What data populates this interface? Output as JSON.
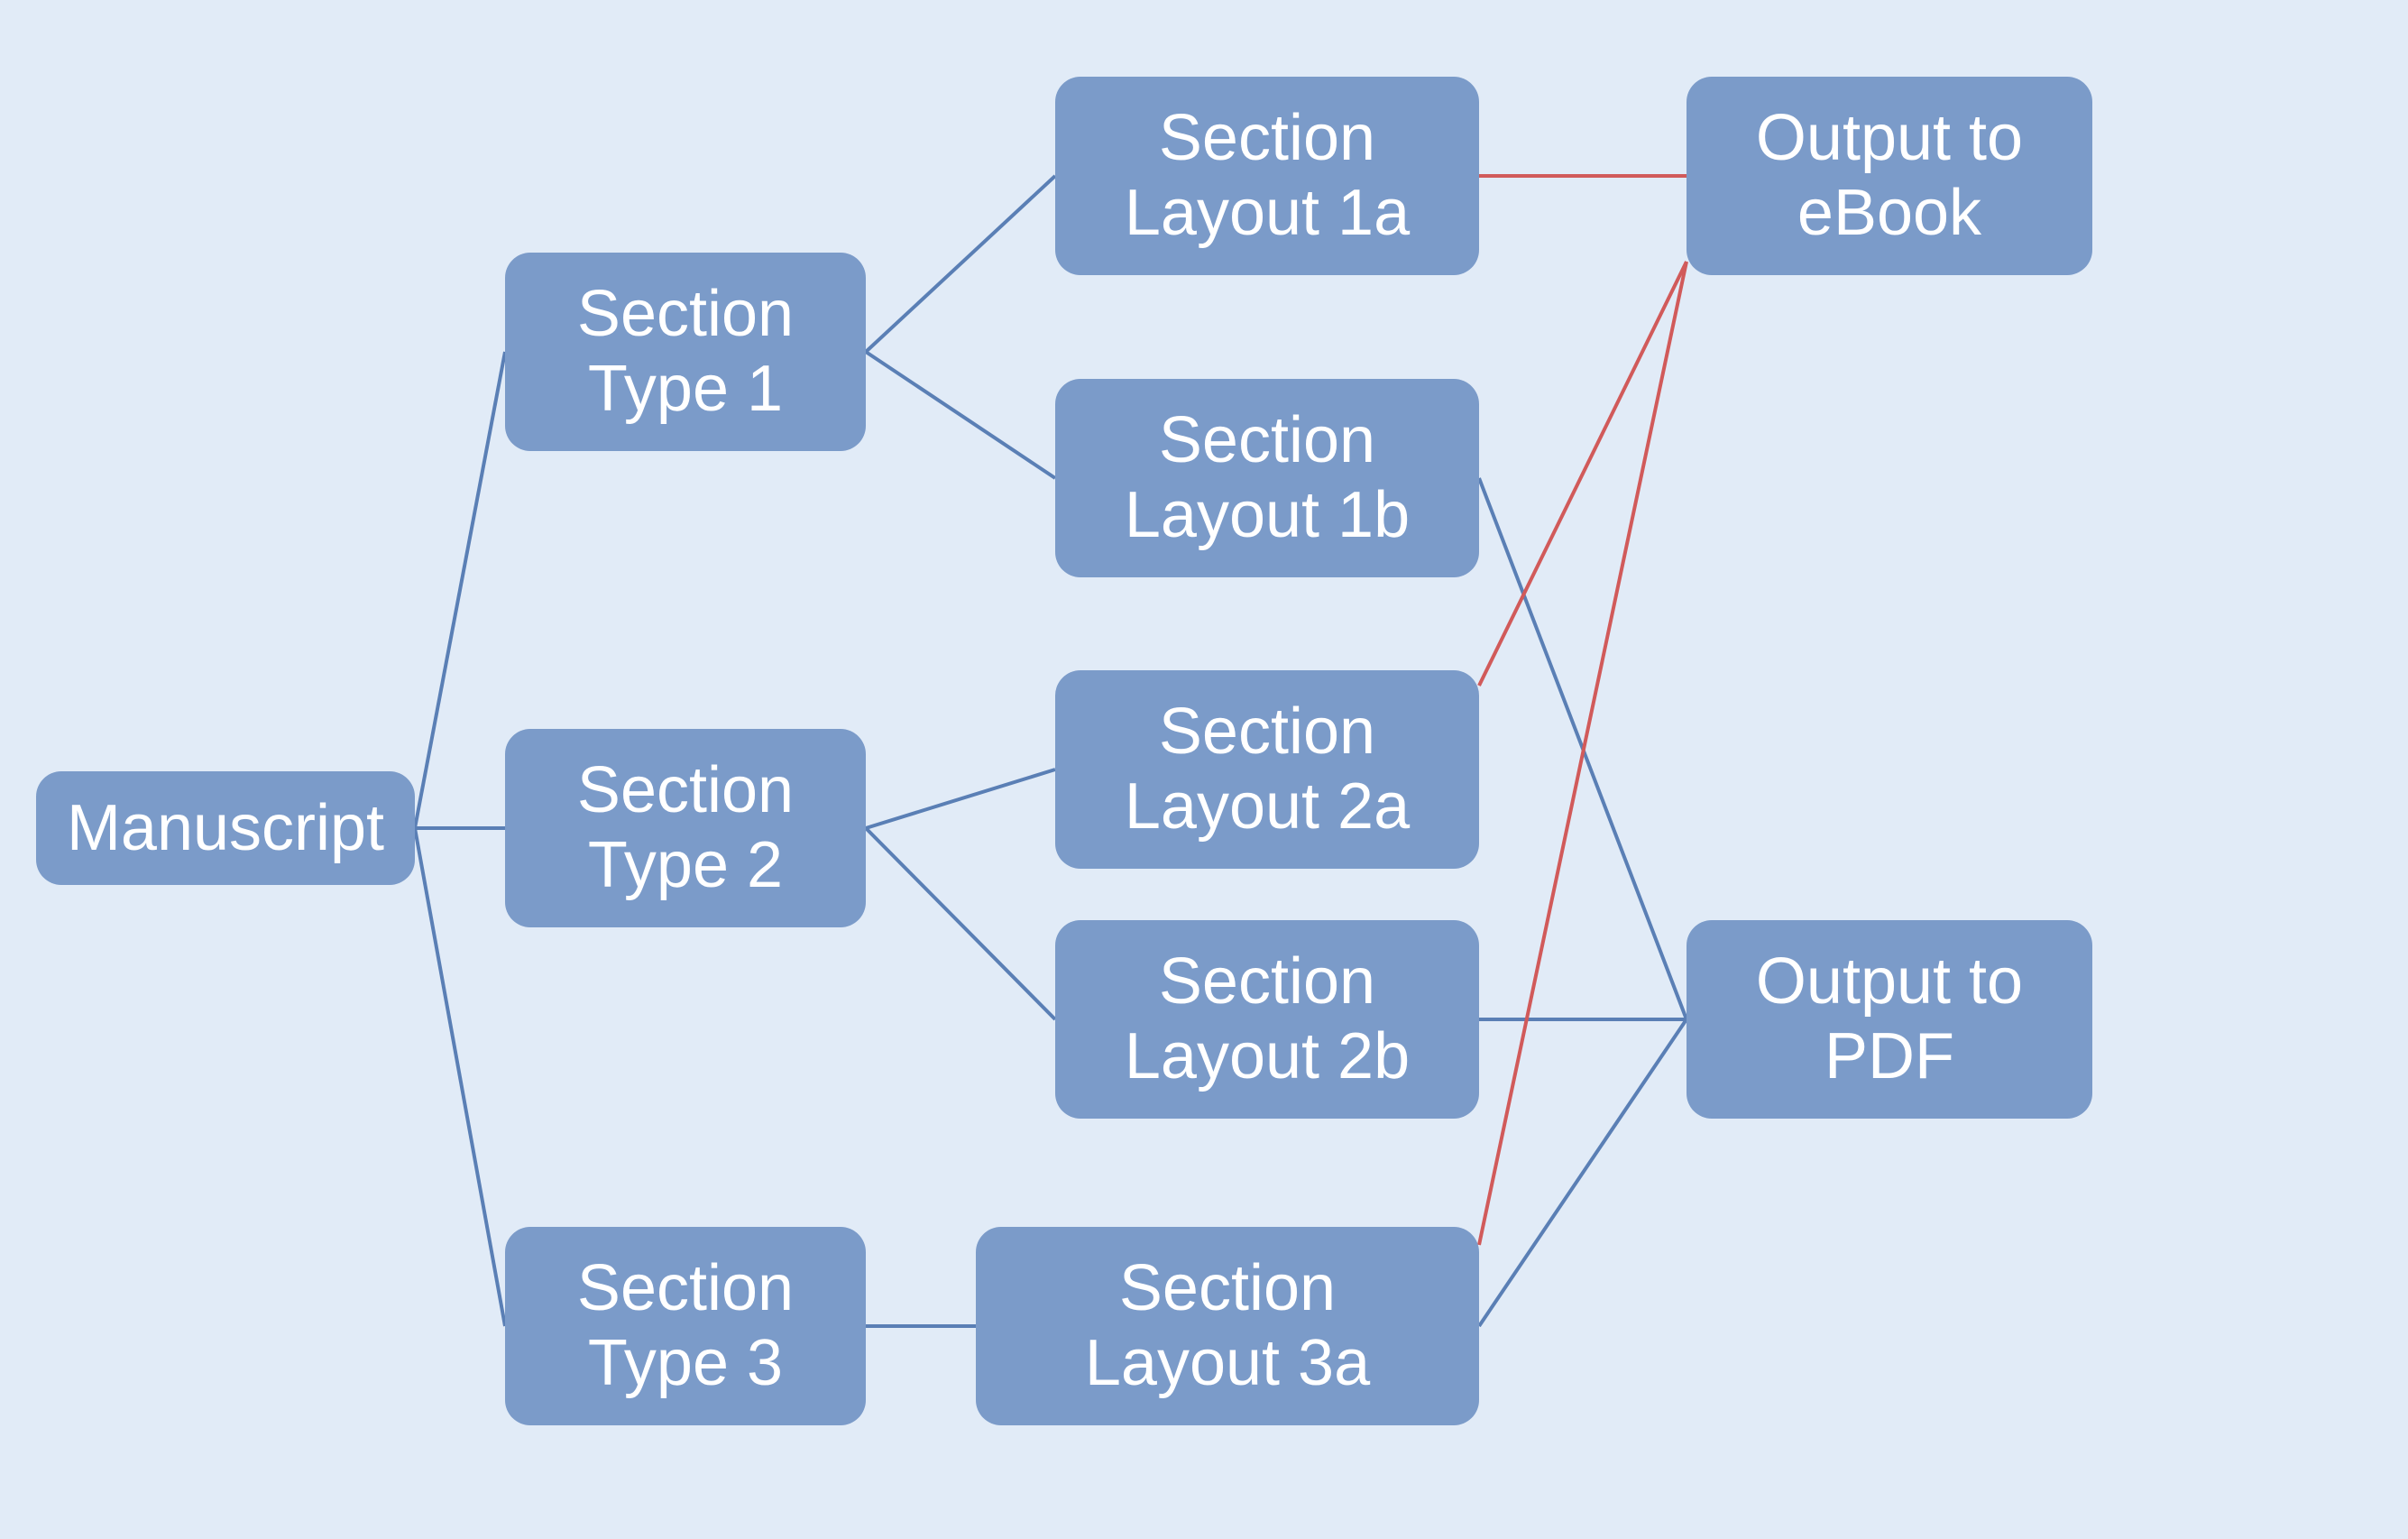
{
  "diagram": {
    "nodes": {
      "manuscript": {
        "label": "Manuscript"
      },
      "section_type_1": {
        "label": "Section\nType 1"
      },
      "section_type_2": {
        "label": "Section\nType 2"
      },
      "section_type_3": {
        "label": "Section\nType 3"
      },
      "section_layout_1a": {
        "label": "Section\nLayout 1a"
      },
      "section_layout_1b": {
        "label": "Section\nLayout 1b"
      },
      "section_layout_2a": {
        "label": "Section\nLayout 2a"
      },
      "section_layout_2b": {
        "label": "Section\nLayout 2b"
      },
      "section_layout_3a": {
        "label": "Section\nLayout 3a"
      },
      "output_ebook": {
        "label": "Output to\neBook"
      },
      "output_pdf": {
        "label": "Output to\nPDF"
      }
    },
    "edges_blue": [
      [
        "manuscript",
        "section_type_1"
      ],
      [
        "manuscript",
        "section_type_2"
      ],
      [
        "manuscript",
        "section_type_3"
      ],
      [
        "section_type_1",
        "section_layout_1a"
      ],
      [
        "section_type_1",
        "section_layout_1b"
      ],
      [
        "section_type_2",
        "section_layout_2a"
      ],
      [
        "section_type_2",
        "section_layout_2b"
      ],
      [
        "section_type_3",
        "section_layout_3a"
      ],
      [
        "section_layout_1b",
        "output_pdf"
      ],
      [
        "section_layout_2b",
        "output_pdf"
      ],
      [
        "section_layout_3a",
        "output_pdf"
      ]
    ],
    "edges_red": [
      [
        "section_layout_1a",
        "output_ebook"
      ],
      [
        "section_layout_2a",
        "output_ebook"
      ],
      [
        "section_layout_3a",
        "output_ebook"
      ]
    ],
    "colors": {
      "node_fill": "#7b9bc9",
      "node_text": "#ffffff",
      "edge_blue": "#5a7fb5",
      "edge_red": "#d15a5a",
      "background": "#e1ebf7"
    }
  }
}
